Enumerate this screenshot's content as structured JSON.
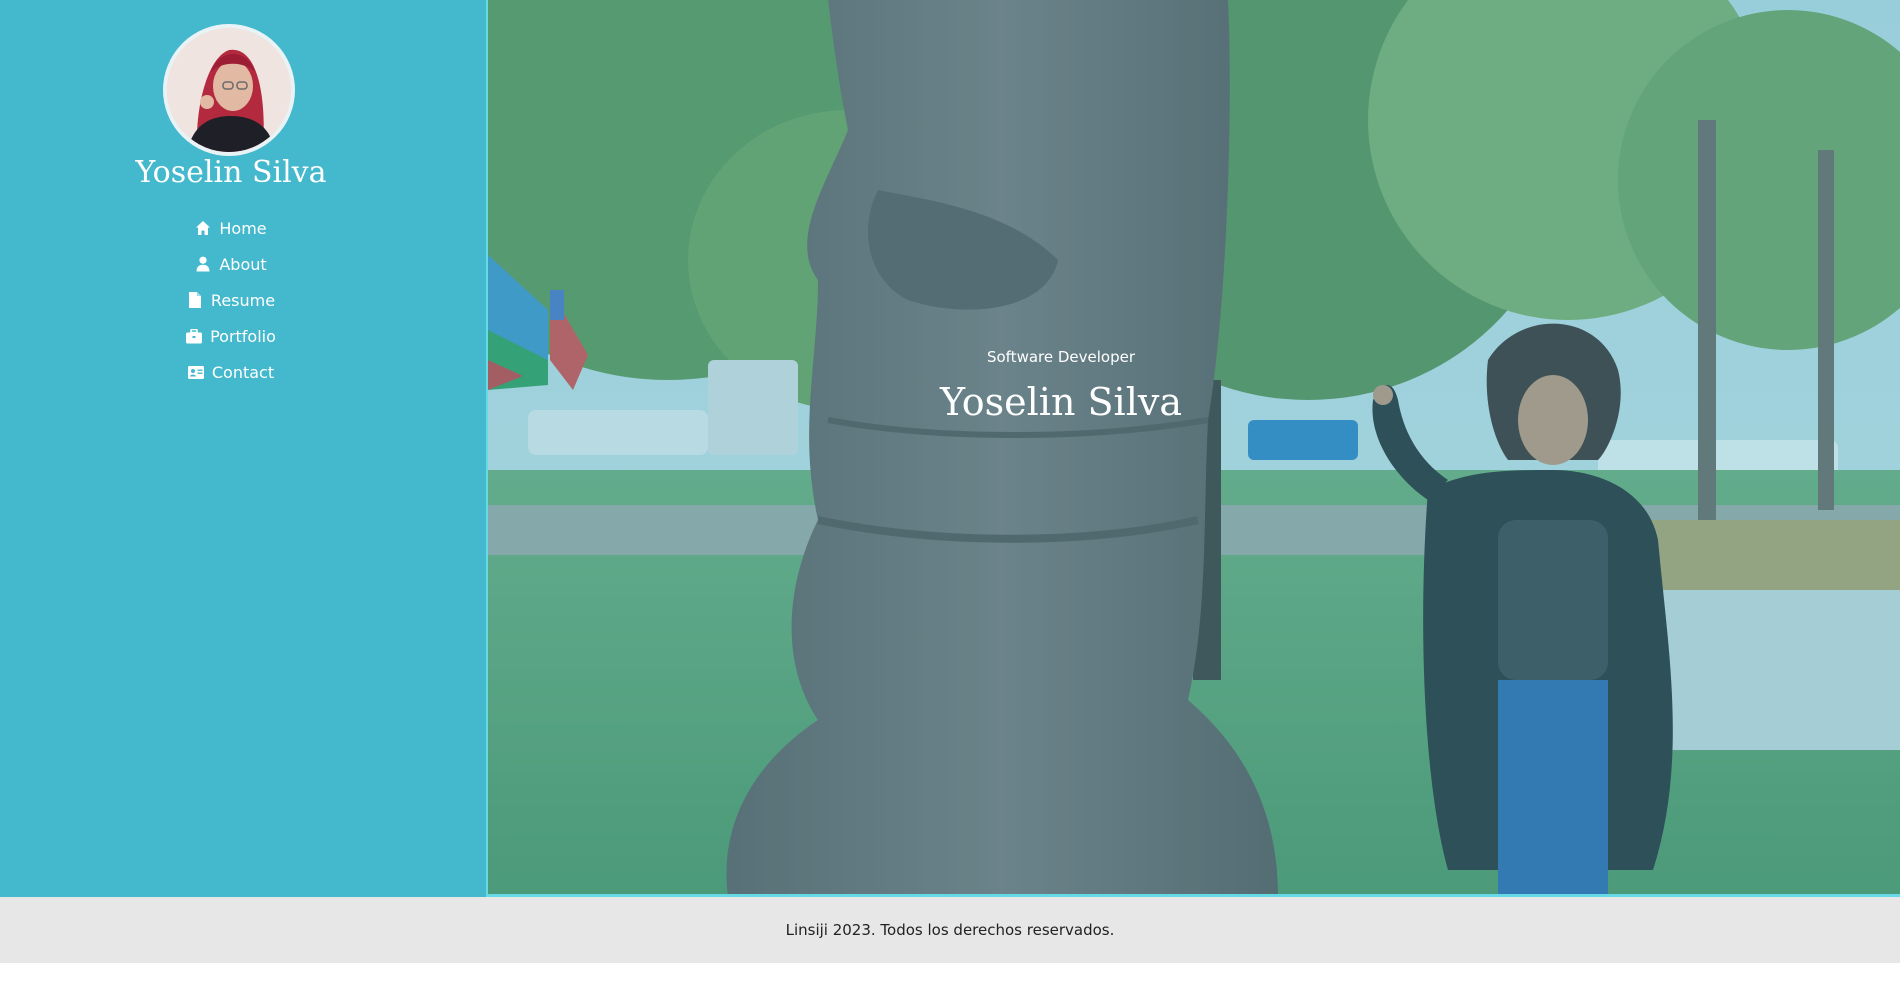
{
  "sidebar": {
    "name": "Yoselin Silva",
    "avatar_alt": "profile-photo",
    "nav": [
      {
        "label": "Home",
        "icon": "home-icon"
      },
      {
        "label": "About",
        "icon": "user-icon"
      },
      {
        "label": "Resume",
        "icon": "file-icon"
      },
      {
        "label": "Portfolio",
        "icon": "briefcase-icon"
      },
      {
        "label": "Contact",
        "icon": "contact-card-icon"
      }
    ]
  },
  "hero": {
    "subtitle": "Software Developer",
    "title": "Yoselin Silva"
  },
  "footer": {
    "text": "Linsiji 2023. Todos los derechos reservados."
  },
  "colors": {
    "sidebar": "#44b8cc",
    "accent_border": "#65d9e6",
    "footer_bg": "#e7e7e7"
  }
}
